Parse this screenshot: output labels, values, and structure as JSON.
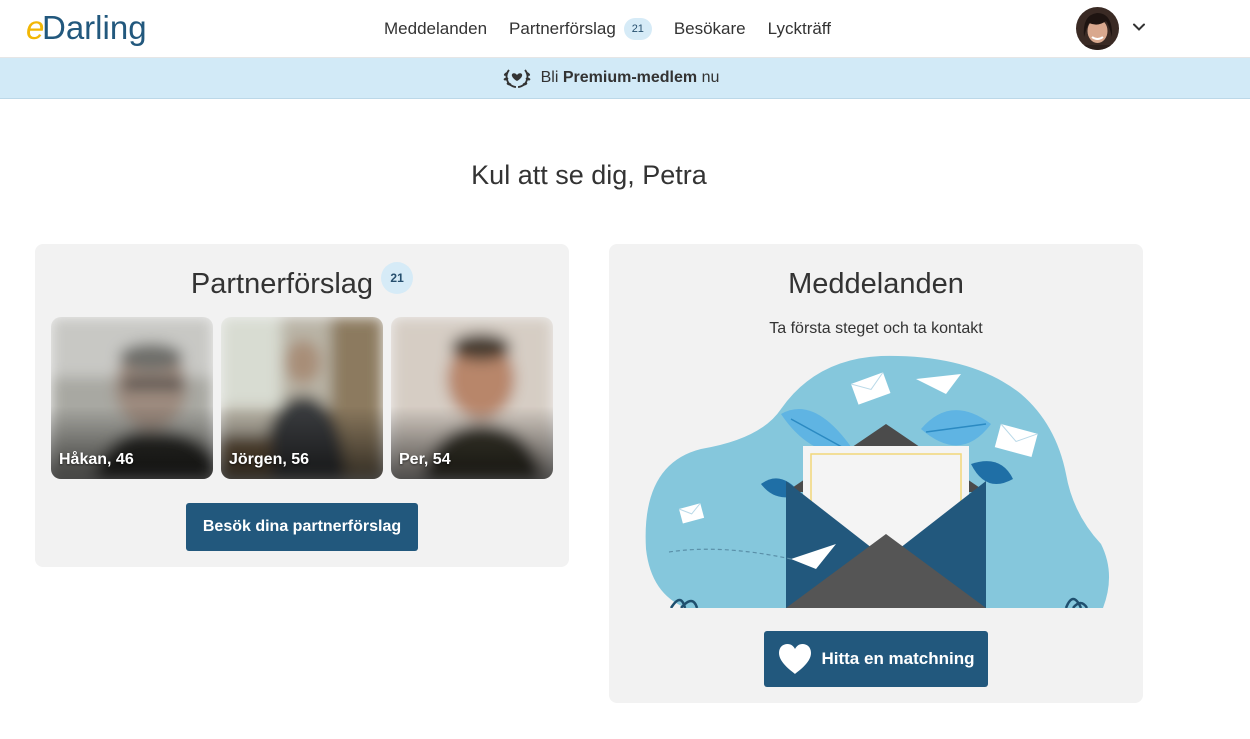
{
  "header": {
    "logo_text": "eDarling",
    "nav": [
      {
        "label": "Meddelanden"
      },
      {
        "label": "Partnerförslag",
        "badge": "21"
      },
      {
        "label": "Besökare"
      },
      {
        "label": "Lyckträff"
      }
    ],
    "avatar_icon": "user-avatar",
    "menu_icon": "chevron-down-icon"
  },
  "banner": {
    "prefix": "Bli",
    "highlight": "Premium-medlem",
    "suffix": "nu",
    "icon": "laurel-heart-icon"
  },
  "greeting": "Kul att se dig, Petra",
  "suggestions": {
    "title": "Partnerförslag",
    "badge": "21",
    "people": [
      {
        "label": "Håkan, 46"
      },
      {
        "label": "Jörgen, 56"
      },
      {
        "label": "Per, 54"
      }
    ],
    "button_label": "Besök dina partnerförslag"
  },
  "messages": {
    "title": "Meddelanden",
    "subtitle": "Ta första steget och ta kontakt",
    "button_label": "Hitta en matchning",
    "button_icon": "heart-icon"
  },
  "colors": {
    "brand_blue": "#22587d",
    "banner_bg": "#d2eaf7",
    "card_bg": "#f2f2f2",
    "logo_yellow": "#f2b705",
    "logo_blue": "#22587d"
  }
}
